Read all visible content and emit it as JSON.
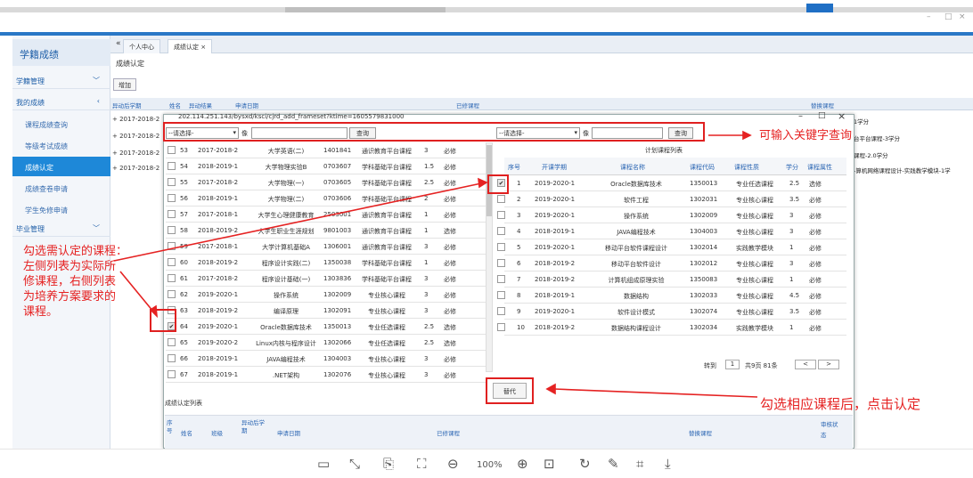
{
  "window": {
    "min": "–",
    "max": "□",
    "close": "×"
  },
  "sidebar": {
    "title": "学籍成绩",
    "sections": [
      {
        "label": "学籍管理",
        "chev": "﹀"
      },
      {
        "label": "我的成绩",
        "chev": "‹"
      },
      {
        "label": "毕业管理",
        "chev": "﹀"
      }
    ],
    "items": [
      "课程成绩查询",
      "等级考试成绩",
      "成绩认定",
      "成绩查卷申请",
      "学生免修申请"
    ]
  },
  "tabs": {
    "back": "«",
    "home": "个人中心",
    "current": "成绩认定",
    "close": "×"
  },
  "breadcrumb": "成绩认定",
  "add_button": "增加",
  "bg_header": [
    "异动后学期",
    "姓名",
    "异动结果",
    "申请日期",
    "已修课程",
    "替换课程"
  ],
  "bg_rows": [
    "+ 2017-2018-2",
    "+ 2017-2018-2",
    "+ 2017-2018-2",
    "+ 2017-2018-2"
  ],
  "bg_right": [
    "1学分",
    "台平台课程-3学分",
    "课程-2.0学分",
    "-算机网络课程设计-实践教学模块-1学"
  ],
  "modal": {
    "url": "202.114.251.143/bysxd/ksci/cjrd_add_frameset?ktime=1605579831000",
    "left_select": "--请选择-",
    "left_like": "像",
    "left_query": "查询",
    "right_select": "--请选择-",
    "right_like": "像",
    "right_query": "查询",
    "right_title": "计划课程列表",
    "right_headers": [
      "序号",
      "开课学期",
      "课程名称",
      "课程代码",
      "课程性质",
      "学分",
      "课程属性"
    ],
    "pager": {
      "goto": "转到",
      "page": "1",
      "total": "共9页 81条",
      "prev": "<",
      "next": ">"
    },
    "replace_button": "替代",
    "record_list_title": "成绩认定列表",
    "record_headers": {
      "seq": "序号",
      "name": "姓名",
      "class": "班级",
      "term": "异动后学期",
      "apply_date": "申请日期",
      "taken": "已修课程",
      "replace": "替换课程",
      "status": "审核状态"
    }
  },
  "left_rows": [
    {
      "no": "53",
      "term": "2017-2018-2",
      "name": "大学英语(二)",
      "code": "1401841",
      "type": "通识教育平台课程",
      "credit": "3",
      "attr": "必修",
      "checked": false
    },
    {
      "no": "54",
      "term": "2018-2019-1",
      "name": "大学物理实验B",
      "code": "0703607",
      "type": "学科基础平台课程",
      "credit": "1.5",
      "attr": "必修",
      "checked": false
    },
    {
      "no": "55",
      "term": "2017-2018-2",
      "name": "大学物理(一)",
      "code": "0703605",
      "type": "学科基础平台课程",
      "credit": "2.5",
      "attr": "必修",
      "checked": false
    },
    {
      "no": "56",
      "term": "2018-2019-1",
      "name": "大学物理(二)",
      "code": "0703606",
      "type": "学科基础平台课程",
      "credit": "2",
      "attr": "必修",
      "checked": false
    },
    {
      "no": "57",
      "term": "2017-2018-1",
      "name": "大学生心理健康教育",
      "code": "2503001",
      "type": "通识教育平台课程",
      "credit": "1",
      "attr": "必修",
      "checked": false
    },
    {
      "no": "58",
      "term": "2018-2019-2",
      "name": "大学生职业生涯规划",
      "code": "9801003",
      "type": "通识教育平台课程",
      "credit": "1",
      "attr": "选修",
      "checked": false
    },
    {
      "no": "59",
      "term": "2017-2018-1",
      "name": "大学计算机基础A",
      "code": "1306001",
      "type": "通识教育平台课程",
      "credit": "3",
      "attr": "必修",
      "checked": false
    },
    {
      "no": "60",
      "term": "2018-2019-2",
      "name": "程序设计实践(二)",
      "code": "1350038",
      "type": "学科基础平台课程",
      "credit": "1",
      "attr": "必修",
      "checked": false
    },
    {
      "no": "61",
      "term": "2017-2018-2",
      "name": "程序设计基础(一)",
      "code": "1303836",
      "type": "学科基础平台课程",
      "credit": "3",
      "attr": "必修",
      "checked": false
    },
    {
      "no": "62",
      "term": "2019-2020-1",
      "name": "操作系统",
      "code": "1302009",
      "type": "专业核心课程",
      "credit": "3",
      "attr": "必修",
      "checked": false
    },
    {
      "no": "63",
      "term": "2018-2019-2",
      "name": "编译原理",
      "code": "1302091",
      "type": "专业核心课程",
      "credit": "3",
      "attr": "必修",
      "checked": false
    },
    {
      "no": "64",
      "term": "2019-2020-1",
      "name": "Oracle数据库技术",
      "code": "1350013",
      "type": "专业任选课程",
      "credit": "2.5",
      "attr": "选修",
      "checked": true
    },
    {
      "no": "65",
      "term": "2019-2020-2",
      "name": "Linux内核与程序设计",
      "code": "1302066",
      "type": "专业任选课程",
      "credit": "2.5",
      "attr": "选修",
      "checked": false
    },
    {
      "no": "66",
      "term": "2018-2019-1",
      "name": "JAVA编程技术",
      "code": "1304003",
      "type": "专业核心课程",
      "credit": "3",
      "attr": "必修",
      "checked": false
    },
    {
      "no": "67",
      "term": "2018-2019-1",
      "name": ".NET架构",
      "code": "1302076",
      "type": "专业核心课程",
      "credit": "3",
      "attr": "必修",
      "checked": false
    }
  ],
  "right_rows": [
    {
      "no": "1",
      "term": "2019-2020-1",
      "name": "Oracle数据库技术",
      "code": "1350013",
      "type": "专业任选课程",
      "credit": "2.5",
      "attr": "选修",
      "checked": true
    },
    {
      "no": "2",
      "term": "2019-2020-1",
      "name": "软件工程",
      "code": "1302031",
      "type": "专业核心课程",
      "credit": "3.5",
      "attr": "必修",
      "checked": false
    },
    {
      "no": "3",
      "term": "2019-2020-1",
      "name": "操作系统",
      "code": "1302009",
      "type": "专业核心课程",
      "credit": "3",
      "attr": "必修",
      "checked": false
    },
    {
      "no": "4",
      "term": "2018-2019-1",
      "name": "JAVA编程技术",
      "code": "1304003",
      "type": "专业核心课程",
      "credit": "3",
      "attr": "必修",
      "checked": false
    },
    {
      "no": "5",
      "term": "2019-2020-1",
      "name": "移动平台软件课程设计",
      "code": "1302014",
      "type": "实践教学模块",
      "credit": "1",
      "attr": "必修",
      "checked": false
    },
    {
      "no": "6",
      "term": "2018-2019-2",
      "name": "移动平台软件设计",
      "code": "1302012",
      "type": "专业核心课程",
      "credit": "3",
      "attr": "必修",
      "checked": false
    },
    {
      "no": "7",
      "term": "2018-2019-2",
      "name": "计算机组成原理实验",
      "code": "1350083",
      "type": "专业核心课程",
      "credit": "1",
      "attr": "必修",
      "checked": false
    },
    {
      "no": "8",
      "term": "2018-2019-1",
      "name": "数据结构",
      "code": "1302033",
      "type": "专业核心课程",
      "credit": "4.5",
      "attr": "必修",
      "checked": false
    },
    {
      "no": "9",
      "term": "2019-2020-1",
      "name": "软件设计模式",
      "code": "1302074",
      "type": "专业核心课程",
      "credit": "3.5",
      "attr": "必修",
      "checked": false
    },
    {
      "no": "10",
      "term": "2018-2019-2",
      "name": "数据结构课程设计",
      "code": "1302034",
      "type": "实践教学模块",
      "credit": "1",
      "attr": "必修",
      "checked": false
    }
  ],
  "annotations": {
    "keyword": "可输入关键字查询",
    "left_note": [
      "勾选需认定的课程：",
      "左侧列表为实际所",
      "修课程，右侧列表",
      "为培养方案要求的",
      "课程。"
    ],
    "confirm": "勾选相应课程后，点击认定"
  },
  "toolbar": {
    "icons": [
      "▭",
      "⤡",
      "⎘",
      "⛶",
      "⊖",
      "⊕",
      "⊡",
      "↻",
      "✎",
      "⌗",
      "⤓"
    ],
    "zoom": "100%"
  }
}
